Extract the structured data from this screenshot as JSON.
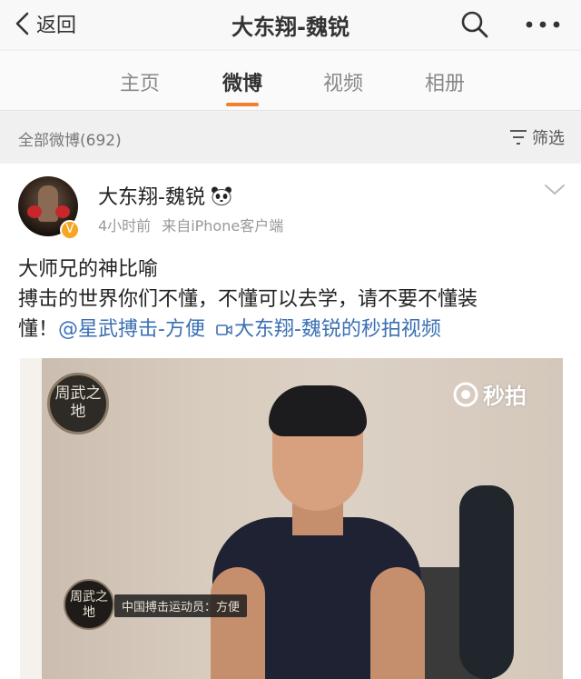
{
  "nav": {
    "back_label": "返回",
    "title": "大东翔-魏锐",
    "search_icon": "search-icon",
    "more_icon": "more-dots-icon"
  },
  "tabs": [
    {
      "label": "主页",
      "active": false
    },
    {
      "label": "微博",
      "active": true
    },
    {
      "label": "视频",
      "active": false
    },
    {
      "label": "相册",
      "active": false
    }
  ],
  "filter_bar": {
    "count_label": "全部微博(692)",
    "filter_label": "筛选",
    "filter_icon": "filter-icon"
  },
  "post": {
    "author": "大东翔-魏锐",
    "author_badge_icon": "panda-icon",
    "verified_icon": "verified-badge-icon",
    "time": "4小时前",
    "source": "来自iPhone客户端",
    "text_line1": "大师兄的神比喻",
    "text_line2": "搏击的世界你们不懂，不懂可以去学，请不要不懂装",
    "text_line3": "懂！",
    "mention": "@星武搏击-方便",
    "video_link": "大东翔-魏锐的秒拍视频",
    "video": {
      "top_left_logo": "周武之地",
      "watermark": "秒拍",
      "caption_logo": "周武之地",
      "caption": "中国搏击运动员：方便"
    }
  },
  "colors": {
    "tab_accent": "#f0802e",
    "link": "#3b70b4",
    "verified": "#f5a623"
  }
}
